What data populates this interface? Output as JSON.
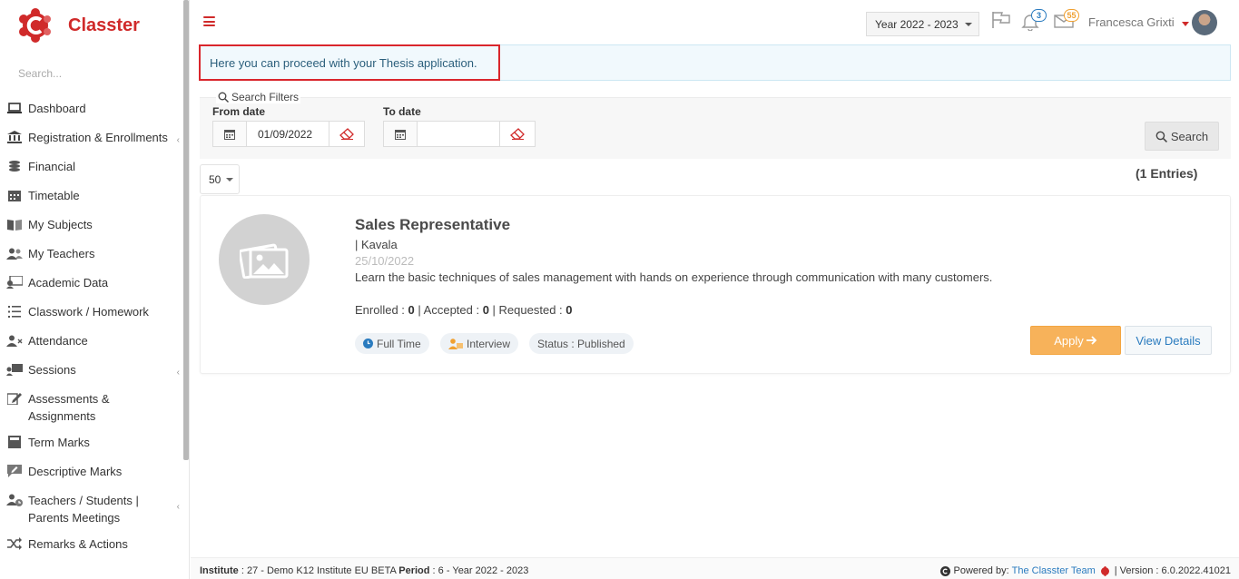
{
  "app": {
    "name": "Classter",
    "brand_color": "#d02a2a"
  },
  "sidebar": {
    "search_placeholder": "Search...",
    "items": [
      {
        "label": "Dashboard",
        "icon": "laptop-icon"
      },
      {
        "label": "Registration & Enrollments",
        "icon": "institution-icon"
      },
      {
        "label": "Financial",
        "icon": "coins-icon"
      },
      {
        "label": "Timetable",
        "icon": "calendar-icon"
      },
      {
        "label": "My Subjects",
        "icon": "book-icon"
      },
      {
        "label": "My Teachers",
        "icon": "users-icon"
      },
      {
        "label": "Academic Data",
        "icon": "id-card-icon"
      },
      {
        "label": "Classwork / Homework",
        "icon": "list-icon"
      },
      {
        "label": "Attendance",
        "icon": "user-x-icon"
      },
      {
        "label": "Sessions",
        "icon": "presentation-icon"
      },
      {
        "label": "Assessments & Assignments",
        "icon": "edit-icon"
      },
      {
        "label": "Term Marks",
        "icon": "notebook-icon"
      },
      {
        "label": "Descriptive Marks",
        "icon": "comment-edit-icon"
      },
      {
        "label": "Teachers / Students | Parents Meetings",
        "icon": "users-clock-icon"
      },
      {
        "label": "Remarks & Actions",
        "icon": "random-icon"
      }
    ]
  },
  "header": {
    "year": "Year 2022 - 2023",
    "notifications_count": "3",
    "messages_count": "55",
    "user_name": "Francesca Grixti"
  },
  "info_banner": "Here you can proceed with your Thesis application.",
  "filters": {
    "legend": "Search Filters",
    "from_label": "From date",
    "from_value": "01/09/2022",
    "to_label": "To date",
    "to_value": "",
    "search_label": "Search"
  },
  "list": {
    "page_size": "50",
    "entries": "(1 Entries)"
  },
  "job": {
    "title": "Sales Representative",
    "location": "| Kavala",
    "date": "25/10/2022",
    "description": "Learn the basic techniques of sales management with hands on experience through communication with many customers.",
    "enrolled_label": "Enrolled : ",
    "enrolled": "0",
    "accepted_label": " | Accepted : ",
    "accepted": "0",
    "requested_label": " | Requested : ",
    "requested": "0",
    "chip_type": "Full Time",
    "chip_interview": "Interview",
    "chip_status": "Status : Published",
    "apply_label": "Apply",
    "view_label": "View Details"
  },
  "footer": {
    "institute_label": "Institute",
    "institute_value": " : 27 - Demo K12 Institute EU BETA ",
    "period_label": "Period",
    "period_value": " : 6 - Year 2022 - 2023",
    "powered_label": "Powered by:",
    "powered_link": "The Classter Team",
    "version": "| Version : 6.0.2022.41021"
  }
}
